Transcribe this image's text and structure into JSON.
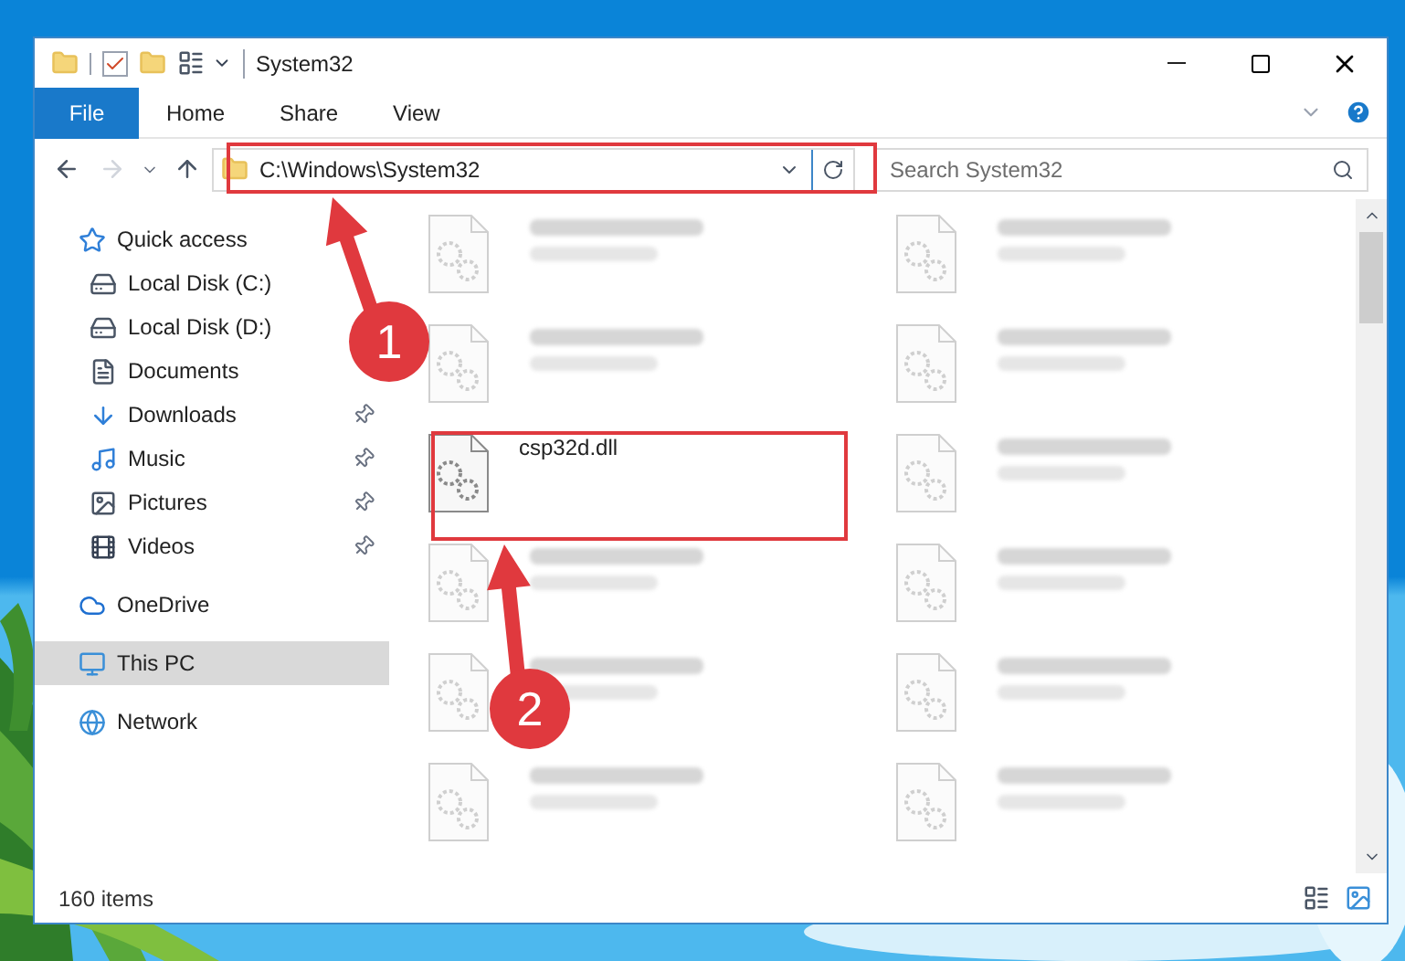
{
  "window": {
    "title": "System32"
  },
  "ribbon_tabs": [
    {
      "label": "File",
      "selected": true
    },
    {
      "label": "Home",
      "selected": false
    },
    {
      "label": "Share",
      "selected": false
    },
    {
      "label": "View",
      "selected": false
    }
  ],
  "address": {
    "path": "C:\\Windows\\System32"
  },
  "search": {
    "placeholder": "Search System32"
  },
  "sidebar": {
    "items": [
      {
        "label": "Quick access",
        "selected": false,
        "children": [
          {
            "label": "Local Disk (C:)",
            "pinned": false,
            "selected": false
          },
          {
            "label": "Local Disk (D:)",
            "pinned": false,
            "selected": false
          },
          {
            "label": "Documents",
            "pinned": false,
            "selected": false
          },
          {
            "label": "Downloads",
            "pinned": true,
            "selected": false
          },
          {
            "label": "Music",
            "pinned": true,
            "selected": false
          },
          {
            "label": "Pictures",
            "pinned": true,
            "selected": false
          },
          {
            "label": "Videos",
            "pinned": true,
            "selected": false
          }
        ]
      },
      {
        "label": "OneDrive",
        "selected": false
      },
      {
        "label": "This PC",
        "selected": true
      },
      {
        "label": "Network",
        "selected": false
      }
    ]
  },
  "files": [
    {
      "kind": "blurred"
    },
    {
      "kind": "blurred"
    },
    {
      "kind": "blurred"
    },
    {
      "kind": "blurred"
    },
    {
      "kind": "file",
      "name": "csp32d.dll"
    },
    {
      "kind": "blurred"
    },
    {
      "kind": "blurred"
    },
    {
      "kind": "blurred"
    },
    {
      "kind": "blurred"
    },
    {
      "kind": "blurred"
    },
    {
      "kind": "blurred"
    },
    {
      "kind": "blurred"
    }
  ],
  "status_bar": {
    "count": "160 items"
  },
  "annotations": [
    {
      "number": "1"
    },
    {
      "number": "2"
    }
  ]
}
